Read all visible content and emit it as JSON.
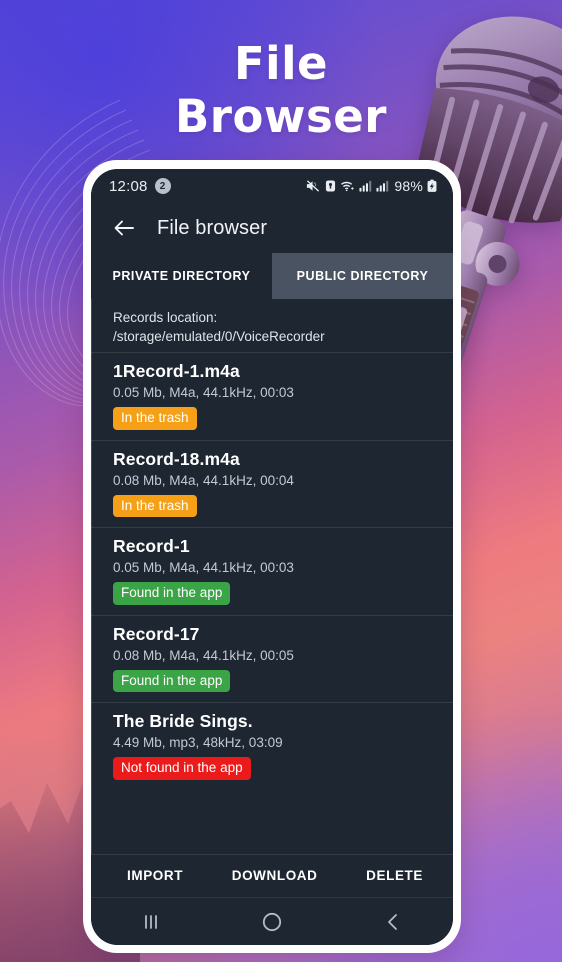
{
  "hero": {
    "line1": "File",
    "line2": "Browser"
  },
  "phone": {
    "statusbar": {
      "time": "12:08",
      "notification_count": "2",
      "battery_percent": "98%",
      "icons": [
        "mute-icon",
        "alarm-icon",
        "wifi-icon",
        "signal-icon",
        "signal-icon",
        "battery-charging-icon"
      ]
    },
    "appbar": {
      "back_icon": "arrow-left-icon",
      "title": "File browser"
    },
    "tabs": [
      {
        "label": "PRIVATE DIRECTORY",
        "active": "true"
      },
      {
        "label": "PUBLIC DIRECTORY",
        "active": "false"
      }
    ],
    "location": {
      "label": "Records location:",
      "path": "/storage/emulated/0/VoiceRecorder"
    },
    "files": [
      {
        "name": "1Record-1.m4a",
        "meta": "0.05 Mb, M4a, 44.1kHz, 00:03",
        "status": "In the trash",
        "status_kind": "trash",
        "status_color": "#f5a016"
      },
      {
        "name": "Record-18.m4a",
        "meta": "0.08 Mb, M4a, 44.1kHz, 00:04",
        "status": "In the trash",
        "status_kind": "trash",
        "status_color": "#f5a016"
      },
      {
        "name": "Record-1",
        "meta": "0.05 Mb, M4a, 44.1kHz, 00:03",
        "status": "Found in the app",
        "status_kind": "found",
        "status_color": "#3ba446"
      },
      {
        "name": "Record-17",
        "meta": "0.08 Mb, M4a, 44.1kHz, 00:05",
        "status": "Found in the app",
        "status_kind": "found",
        "status_color": "#3ba446"
      },
      {
        "name": "The Bride Sings.",
        "meta": "4.49 Mb, mp3, 48kHz, 03:09",
        "status": "Not found in the app",
        "status_kind": "notfound",
        "status_color": "#ec1b1b"
      }
    ],
    "actions": [
      {
        "label": "IMPORT"
      },
      {
        "label": "DOWNLOAD"
      },
      {
        "label": "DELETE"
      }
    ],
    "navbar": [
      {
        "icon": "recents-icon"
      },
      {
        "icon": "home-icon"
      },
      {
        "icon": "back-icon"
      }
    ]
  },
  "decor": {
    "microphone": "vintage-microphone-image",
    "swirl": "wave-lines-decoration"
  },
  "colors": {
    "screen_bg": "#1e2632",
    "tab_inactive_bg": "#4a5361",
    "accent_trash": "#f5a016",
    "accent_found": "#3ba446",
    "accent_notfound": "#ec1b1b",
    "gradient_start": "#5547d6",
    "gradient_mid": "#ee7b7f",
    "gradient_end": "#9768d8"
  }
}
